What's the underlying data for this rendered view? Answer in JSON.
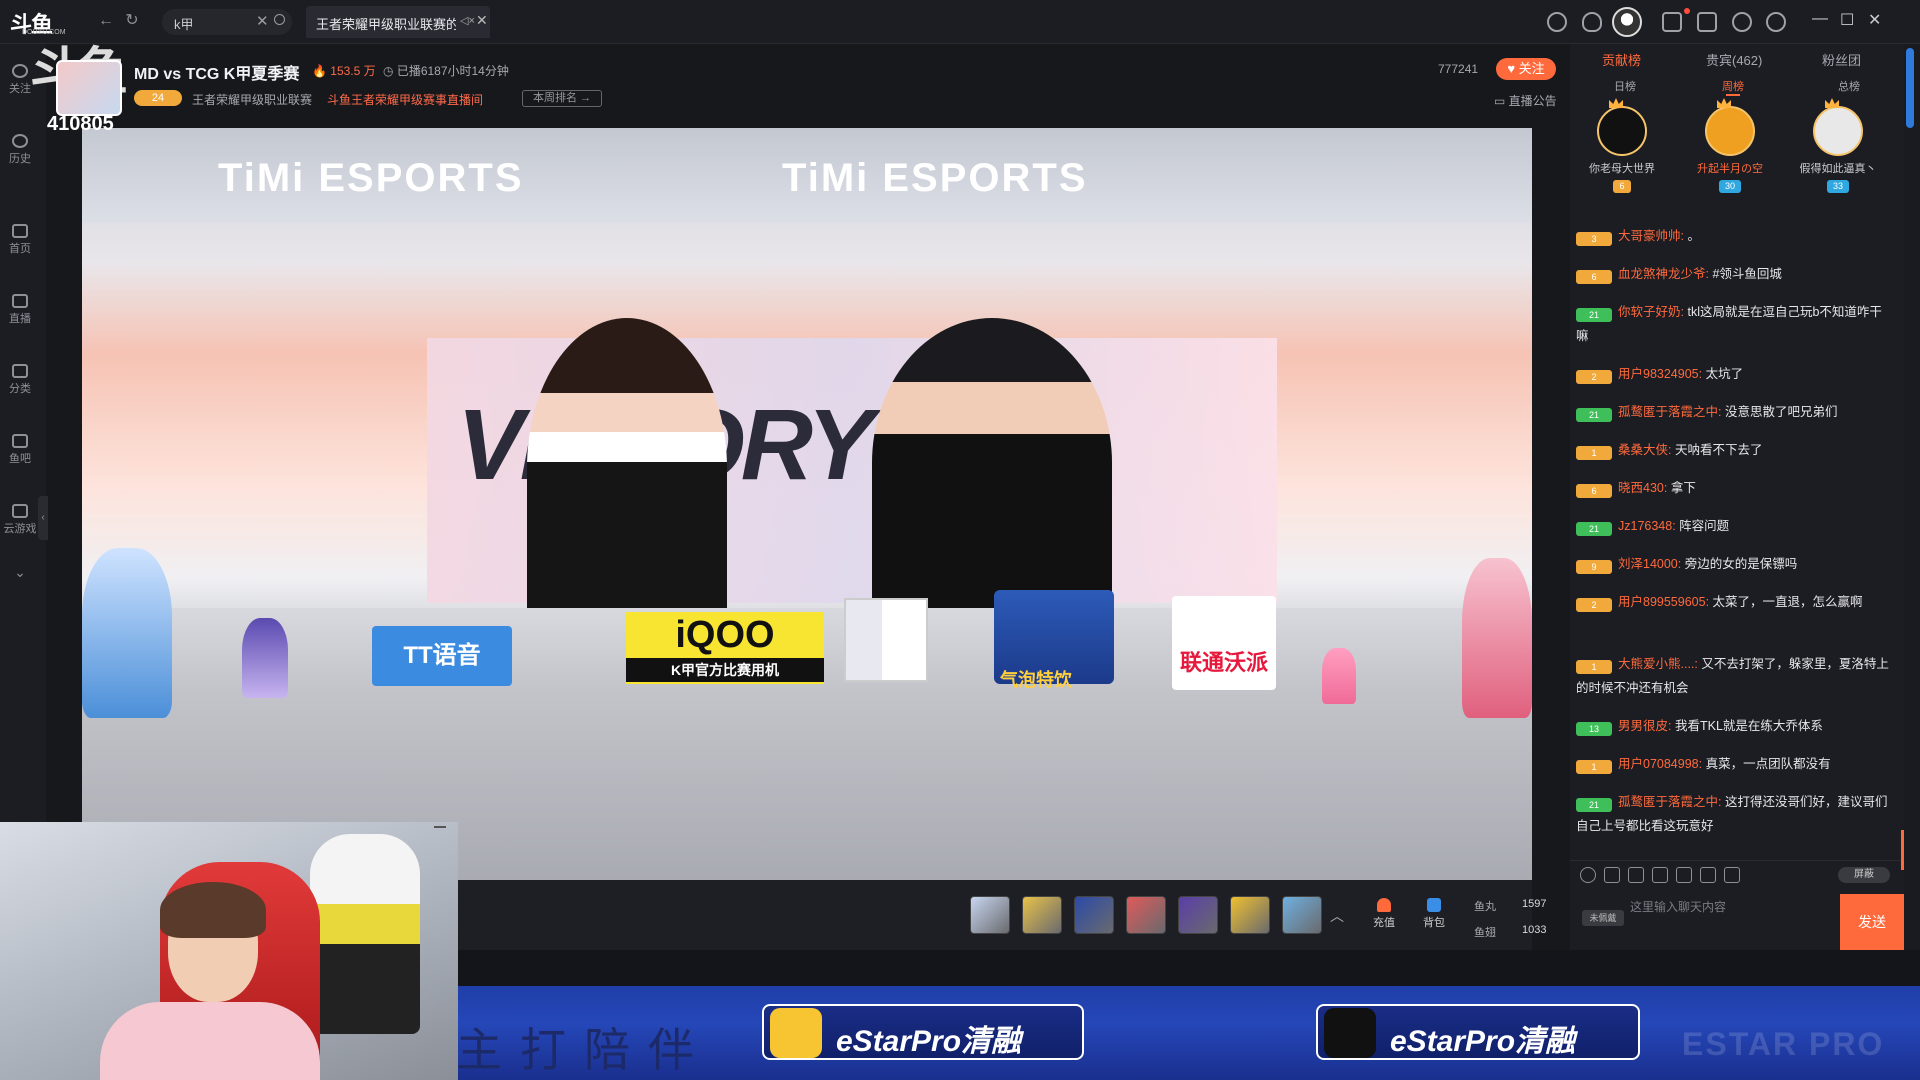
{
  "topbar": {
    "logo": "斗鱼",
    "logo_sub": "DOUYU.COM",
    "search_value": "k甲",
    "tab_label": "王者荣耀甲级职业联赛的...",
    "window_controls": [
      "—",
      "☐",
      "✕"
    ]
  },
  "sidebar": {
    "items": [
      {
        "label": "关注",
        "icon": "heart-icon"
      },
      {
        "label": "历史",
        "icon": "clock-icon"
      },
      {
        "label": "首页",
        "icon": "home-icon"
      },
      {
        "label": "直播",
        "icon": "tv-icon"
      },
      {
        "label": "分类",
        "icon": "grid-icon"
      },
      {
        "label": "鱼吧",
        "icon": "fish-icon"
      },
      {
        "label": "云游戏",
        "icon": "gamepad-icon"
      }
    ]
  },
  "room": {
    "watermark": "斗鱼",
    "room_id": "410805",
    "title": "MD vs TCG K甲夏季赛",
    "hot": "153.5 万",
    "duration": "已播6187小时14分钟",
    "level_badge": "24",
    "category": "王者荣耀甲级职业联赛",
    "subcategory": "斗鱼王者荣耀甲级赛事直播间",
    "rank_btn": "本周排名 →",
    "follow_count": "777241",
    "follow_label": "关注",
    "announce": "直播公告"
  },
  "video": {
    "banner_left": "TiMi ESPORTS",
    "banner_right": "TiMi ESPORTS",
    "backdrop": "VICTORY",
    "sponsor_tt": "TT语音",
    "sponsor_iqoo": "iQOO",
    "sponsor_iqoo_sub": "K甲官方比赛用机",
    "sponsor_drink": "气泡特饮",
    "sponsor_unicom": "联通沃派"
  },
  "giftbar": {
    "gift_colors": [
      "#c8d6f0",
      "#e9c24a",
      "#2b4aa8",
      "#e05a5a",
      "#5a3ea8",
      "#f0c030",
      "#6fb0e0"
    ],
    "recharge": "充值",
    "bag": "背包",
    "fishball_label": "鱼丸",
    "fishball_value": "1597",
    "fishfin_label": "鱼翅",
    "fishfin_value": "1033"
  },
  "overlay": {
    "hand_text": "主打陪伴",
    "weibo": "eStarPro清融",
    "douyin": "eStarPro清融",
    "team_mark": "ESTAR PRO"
  },
  "rpanel": {
    "tabs": [
      "贡献榜",
      "贵宾(462)",
      "粉丝团"
    ],
    "subtabs": [
      "日榜",
      "周榜",
      "总榜"
    ],
    "ranks": [
      {
        "name": "你老母大世界",
        "badge": "6",
        "color": "#222"
      },
      {
        "name": "升起半月の空",
        "badge": "30",
        "color": "#f0a020"
      },
      {
        "name": "假得如此逼真丶",
        "badge": "33",
        "color": "#e8e8e8"
      }
    ],
    "chat": [
      {
        "lv": "3",
        "lvcolor": "#f2a93b",
        "name": "大哥豪帅帅",
        "text": "。"
      },
      {
        "lv": "6",
        "lvcolor": "#f2a93b",
        "name": "血龙煞神龙少爷",
        "text": "#领斗鱼回城"
      },
      {
        "lv": "21",
        "lvcolor": "#3fbf5a",
        "name": "你软子好奶",
        "text": "tkl这局就是在逗自己玩b不知道咋干嘛"
      },
      {
        "lv": "2",
        "lvcolor": "#f2a93b",
        "name": "用户98324905",
        "text": "太坑了"
      },
      {
        "lv": "21",
        "lvcolor": "#3fbf5a",
        "name": "孤鹜匿于落霞之中",
        "text": "没意思散了吧兄弟们"
      },
      {
        "lv": "1",
        "lvcolor": "#f2a93b",
        "name": "桑桑大侠",
        "text": "天呐看不下去了"
      },
      {
        "lv": "6",
        "lvcolor": "#f2a93b",
        "name": "晓西430",
        "text": "拿下"
      },
      {
        "lv": "21",
        "lvcolor": "#3fbf5a",
        "name": "Jz176348",
        "text": "阵容问题"
      },
      {
        "lv": "9",
        "lvcolor": "#f2a93b",
        "name": "刘泽14000",
        "text": "旁边的女的是保镖吗"
      },
      {
        "lv": "2",
        "lvcolor": "#f2a93b",
        "name": "用户899559605",
        "text": "太菜了，一直退，怎么赢啊"
      },
      {
        "lv": "1",
        "lvcolor": "#f2a93b",
        "name": "大熊爱小熊....",
        "text": "又不去打架了，躲家里，夏洛特上的时候不冲还有机会"
      },
      {
        "lv": "13",
        "lvcolor": "#3fbf5a",
        "name": "男男很皮",
        "text": "我看TKL就是在练大乔体系"
      },
      {
        "lv": "1",
        "lvcolor": "#f2a93b",
        "name": "用户07084998",
        "text": "真菜，一点团队都没有"
      },
      {
        "lv": "21",
        "lvcolor": "#3fbf5a",
        "name": "孤鹜匿于落霞之中",
        "text": "这打得还没哥们好，建议哥们自己上号都比看这玩意好"
      }
    ],
    "shield": "屏蔽",
    "input_placeholder": "这里输入聊天内容",
    "unlogged": "未佩戴",
    "send": "发送"
  }
}
